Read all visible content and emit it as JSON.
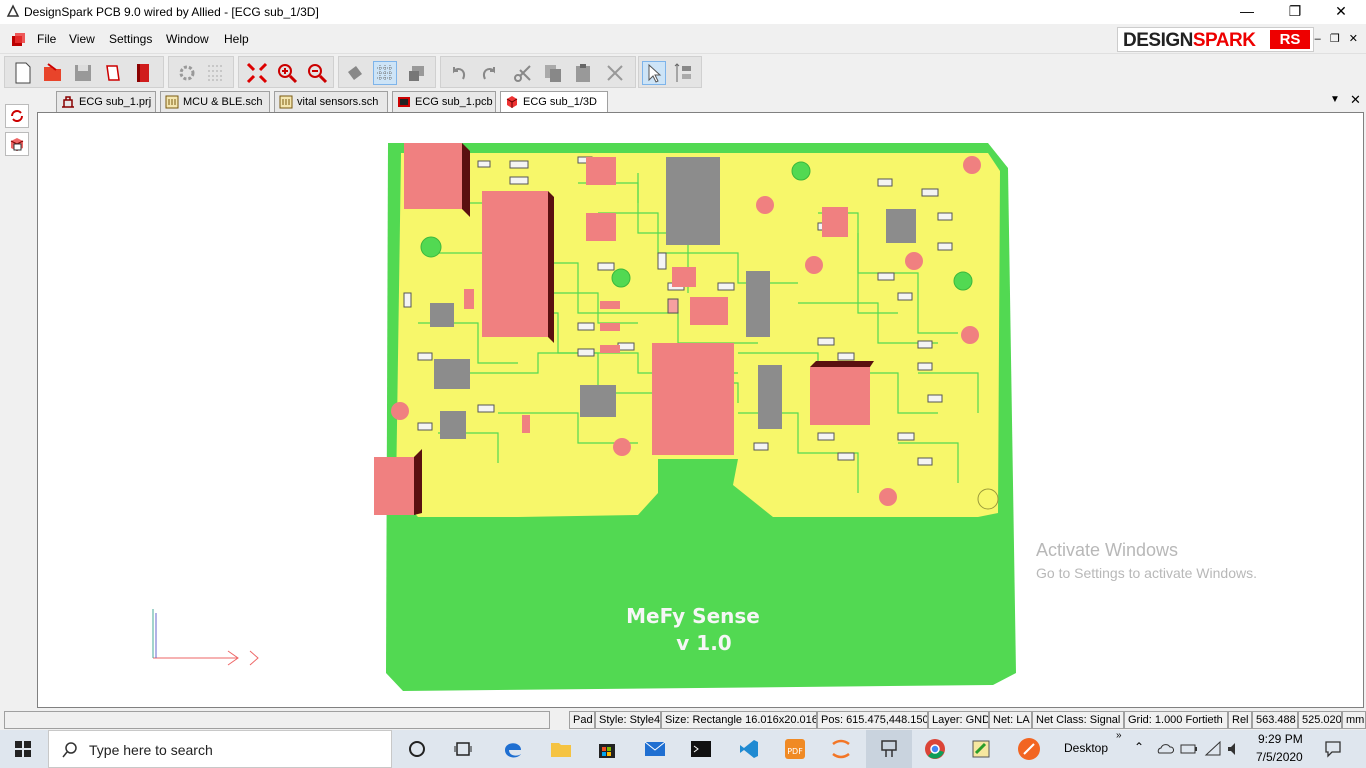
{
  "window": {
    "title": "DesignSpark PCB 9.0 wired by Allied - [ECG sub_1/3D]"
  },
  "menu": [
    "File",
    "View",
    "Settings",
    "Window",
    "Help"
  ],
  "brand": {
    "part1": "DESIGN",
    "part2": "SPARK",
    "badge": "RS"
  },
  "tabs": [
    {
      "label": "ECG sub_1.prj",
      "icon": "project-icon"
    },
    {
      "label": "MCU & BLE.sch",
      "icon": "schematic-icon"
    },
    {
      "label": "vital sensors.sch",
      "icon": "schematic-icon"
    },
    {
      "label": "ECG sub_1.pcb",
      "icon": "pcb-icon"
    },
    {
      "label": "ECG sub_1/3D",
      "icon": "3d-icon",
      "active": true
    }
  ],
  "board": {
    "title": "MeFy Sense",
    "version": "v 1.0"
  },
  "watermark": {
    "line1": "Activate Windows",
    "line2": "Go to Settings to activate Windows."
  },
  "status": {
    "mode": "Pad",
    "style": "Style: Style4",
    "size": "Size: Rectangle 16.016x20.016",
    "pos": "Pos: 615.475,448.150",
    "layer": "Layer: GND",
    "net": "Net: LA",
    "netclass": "Net Class: Signal",
    "grid": "Grid: 1.000 Fortieth",
    "rel": "Rel",
    "x": "563.488",
    "y": "525.020",
    "units": "mm"
  },
  "taskbar": {
    "search_placeholder": "Type here to search",
    "desktop_label": "Desktop",
    "time": "9:29 PM",
    "date": "7/5/2020"
  },
  "colors": {
    "board_green": "#52d952",
    "board_yellow": "#f7f76a",
    "component_red": "#f08080",
    "ic_gray": "#8c8c8c"
  }
}
